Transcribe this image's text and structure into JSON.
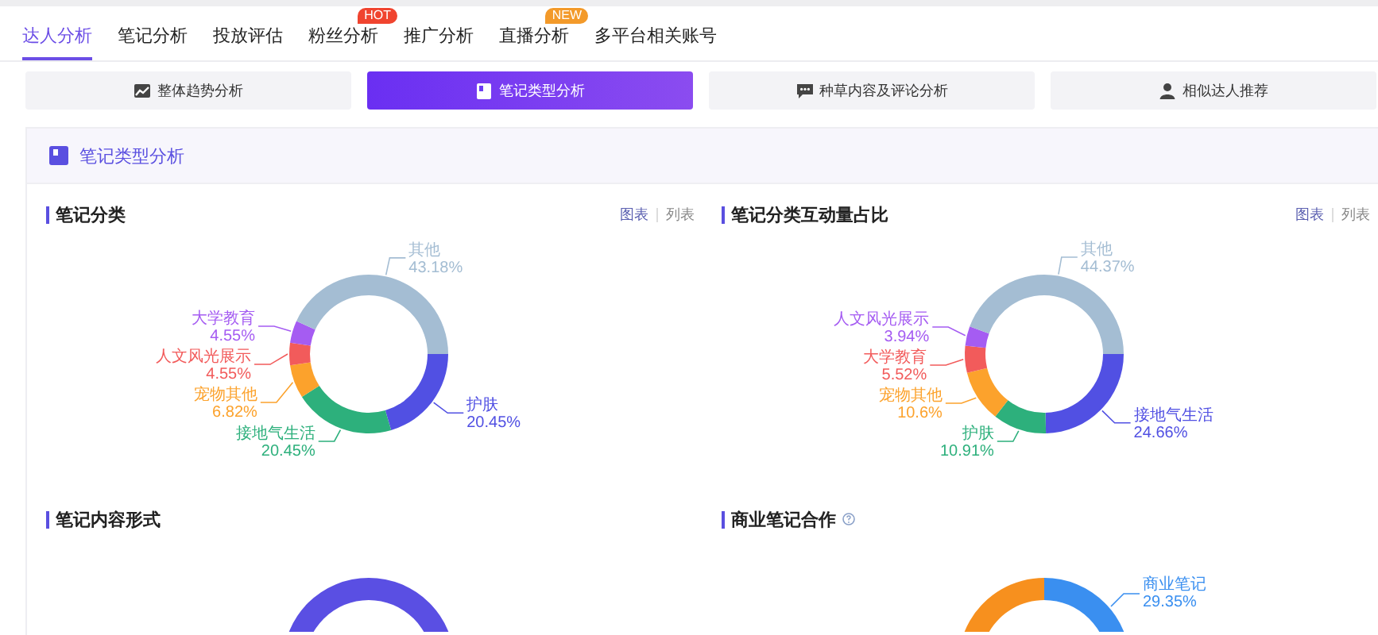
{
  "nav_tabs": [
    {
      "label": "达人分析",
      "selected": true
    },
    {
      "label": "笔记分析",
      "selected": false
    },
    {
      "label": "投放评估",
      "selected": false
    },
    {
      "label": "粉丝分析",
      "selected": false,
      "badge": {
        "text": "HOT",
        "color": "#f0442f"
      }
    },
    {
      "label": "推广分析",
      "selected": false
    },
    {
      "label": "直播分析",
      "selected": false,
      "badge": {
        "text": "NEW",
        "color": "#f39a2a"
      }
    },
    {
      "label": "多平台相关账号",
      "selected": false
    }
  ],
  "sub_tabs": [
    {
      "label": "整体趋势分析",
      "selected": false
    },
    {
      "label": "笔记类型分析",
      "selected": true
    },
    {
      "label": "种草内容及评论分析",
      "selected": false
    },
    {
      "label": "相似达人推荐",
      "selected": false
    }
  ],
  "panel": {
    "title": "笔记类型分析",
    "sections": [
      {
        "title": "笔记分类",
        "views": [
          {
            "label": "图表",
            "selected": true
          },
          {
            "label": "列表",
            "selected": false
          }
        ],
        "chart_data": {
          "type": "donut",
          "categories": [
            "护肤",
            "接地气生活",
            "宠物其他",
            "人文风光展示",
            "大学教育",
            "其他"
          ],
          "values": [
            20.45,
            20.45,
            6.82,
            4.55,
            4.55,
            43.18
          ],
          "value_labels": [
            "20.45%",
            "20.45%",
            "6.82%",
            "4.55%",
            "4.55%",
            "43.18%"
          ],
          "colors": [
            "#5150e3",
            "#2db07c",
            "#fca22c",
            "#f25b5b",
            "#a55cf2",
            "#a4bdd3"
          ]
        }
      },
      {
        "title": "笔记分类互动量占比",
        "views": [
          {
            "label": "图表",
            "selected": true
          },
          {
            "label": "列表",
            "selected": false
          }
        ],
        "chart_data": {
          "type": "donut",
          "categories": [
            "接地气生活",
            "护肤",
            "宠物其他",
            "大学教育",
            "人文风光展示",
            "其他"
          ],
          "values": [
            24.66,
            10.91,
            10.6,
            5.52,
            3.94,
            44.37
          ],
          "value_labels": [
            "24.66%",
            "10.91%",
            "10.6%",
            "5.52%",
            "3.94%",
            "44.37%"
          ],
          "colors": [
            "#5150e3",
            "#2db07c",
            "#fca22c",
            "#f25b5b",
            "#a55cf2",
            "#a4bdd3"
          ]
        }
      },
      {
        "title": "笔记内容形式",
        "kind": "ring"
      },
      {
        "title": "商业笔记合作",
        "help": true,
        "kind": "split",
        "label": "商业笔记",
        "label_value": "29.35%"
      }
    ]
  }
}
